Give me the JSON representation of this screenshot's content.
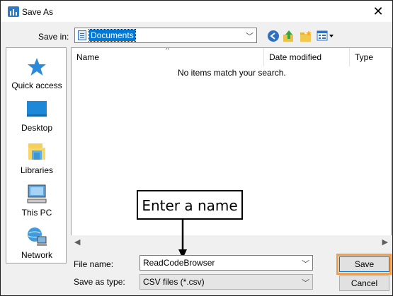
{
  "window": {
    "title": "Save As",
    "close_glyph": "✕"
  },
  "toolbar": {
    "save_in_label": "Save in:",
    "save_in_value": "Documents",
    "icons": [
      "back-icon",
      "up-folder-icon",
      "new-folder-icon",
      "views-menu-icon"
    ]
  },
  "places": [
    {
      "label": "Quick access",
      "icon": "star-icon"
    },
    {
      "label": "Desktop",
      "icon": "desktop-icon"
    },
    {
      "label": "Libraries",
      "icon": "libraries-icon"
    },
    {
      "label": "This PC",
      "icon": "computer-icon"
    },
    {
      "label": "Network",
      "icon": "network-icon"
    }
  ],
  "filelist": {
    "columns": [
      "Name",
      "Date modified",
      "Type"
    ],
    "empty_message": "No items match your search."
  },
  "annotation": {
    "text": "Enter a name"
  },
  "form": {
    "file_name_label": "File name:",
    "file_name_value": "ReadCodeBrowser",
    "save_as_type_label": "Save as type:",
    "save_as_type_value": "CSV files (*.csv)"
  },
  "buttons": {
    "save": "Save",
    "cancel": "Cancel"
  },
  "colors": {
    "selection": "#0078d7",
    "highlight": "#f59d4a"
  }
}
